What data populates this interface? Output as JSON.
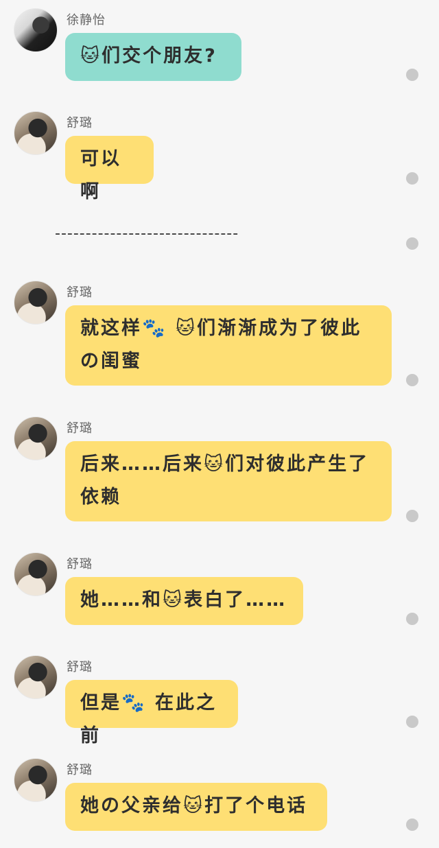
{
  "messages": [
    {
      "sender": "徐静怡",
      "text": "🐱们交个朋友?",
      "color": "#8fdccf"
    },
    {
      "sender": "舒璐",
      "text": "可以啊",
      "color": "#fedf74"
    },
    {
      "sender": "舒璐",
      "text": "就这样🐾 🐱们渐渐成为了彼此の闺蜜",
      "color": "#fedf74"
    },
    {
      "sender": "舒璐",
      "text": "后来……后来🐱们对彼此产生了依赖",
      "color": "#fedf74"
    },
    {
      "sender": "舒璐",
      "text": "她……和🐱表白了……",
      "color": "#fedf74"
    },
    {
      "sender": "舒璐",
      "text": "但是🐾 在此之前",
      "color": "#fedf74"
    },
    {
      "sender": "舒璐",
      "text": "她の父亲给🐱打了个电话",
      "color": "#fedf74"
    }
  ],
  "divider": "------------------------------"
}
